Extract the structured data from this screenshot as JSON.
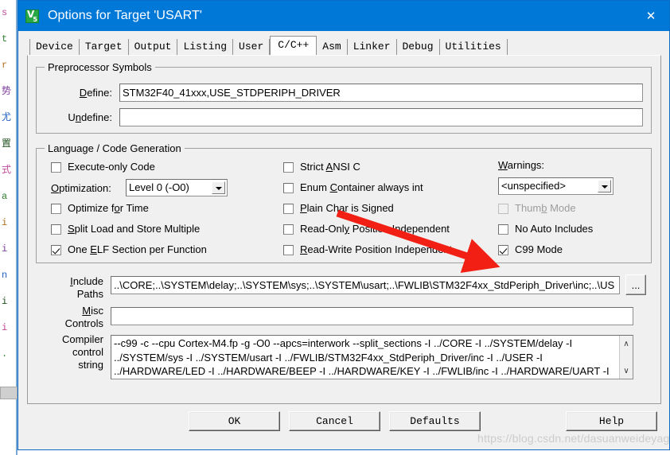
{
  "window": {
    "title": "Options for Target 'USART'",
    "icon": "keil-uvision-icon",
    "close_label": "✕"
  },
  "tabs": [
    {
      "label": "Device",
      "active": false
    },
    {
      "label": "Target",
      "active": false
    },
    {
      "label": "Output",
      "active": false
    },
    {
      "label": "Listing",
      "active": false
    },
    {
      "label": "User",
      "active": false
    },
    {
      "label": "C/C++",
      "active": true
    },
    {
      "label": "Asm",
      "active": false
    },
    {
      "label": "Linker",
      "active": false
    },
    {
      "label": "Debug",
      "active": false
    },
    {
      "label": "Utilities",
      "active": false
    }
  ],
  "preprocessor": {
    "legend": "Preprocessor Symbols",
    "define_label": "Define:",
    "define_value": "STM32F40_41xxx,USE_STDPERIPH_DRIVER",
    "undefine_label": "Undefine:",
    "undefine_value": ""
  },
  "language": {
    "legend": "Language / Code Generation",
    "left_column": [
      {
        "label": "Execute-only Code",
        "checked": false,
        "enabled": true
      },
      {
        "label": "Optimize for Time",
        "checked": false,
        "enabled": true
      },
      {
        "label": "Split Load and Store Multiple",
        "checked": false,
        "enabled": true
      },
      {
        "label": "One ELF Section per Function",
        "checked": true,
        "enabled": true
      }
    ],
    "optimization_label": "Optimization:",
    "optimization_value": "Level 0 (-O0)",
    "middle_column": [
      {
        "label": "Strict ANSI C",
        "checked": false,
        "enabled": true
      },
      {
        "label": "Enum Container always int",
        "checked": false,
        "enabled": true
      },
      {
        "label": "Plain Char is Signed",
        "checked": false,
        "enabled": true
      },
      {
        "label": "Read-Only Position Independent",
        "checked": false,
        "enabled": true
      },
      {
        "label": "Read-Write Position Independent",
        "checked": false,
        "enabled": true
      }
    ],
    "warnings_label": "Warnings:",
    "warnings_value": "<unspecified>",
    "right_column": [
      {
        "label": "Thumb Mode",
        "checked": false,
        "enabled": false
      },
      {
        "label": "No Auto Includes",
        "checked": false,
        "enabled": true
      },
      {
        "label": "C99 Mode",
        "checked": true,
        "enabled": true
      }
    ]
  },
  "paths": {
    "include_label_line1": "Include",
    "include_label_line2": "Paths",
    "include_value": "..\\CORE;..\\SYSTEM\\delay;..\\SYSTEM\\sys;..\\SYSTEM\\usart;..\\FWLIB\\STM32F4xx_StdPeriph_Driver\\inc;..\\US",
    "browse_label": "...",
    "misc_label_line1": "Misc",
    "misc_label_line2": "Controls",
    "misc_value": ""
  },
  "compiler": {
    "label_line1": "Compiler",
    "label_line2": "control",
    "label_line3": "string",
    "value_lines": [
      "--c99 -c --cpu Cortex-M4.fp -g -O0 --apcs=interwork --split_sections -I ../CORE -I ../SYSTEM/delay -I",
      "../SYSTEM/sys -I ../SYSTEM/usart -I ../FWLIB/STM32F4xx_StdPeriph_Driver/inc -I ../USER -I",
      "../HARDWARE/LED -I ../HARDWARE/BEEP -I ../HARDWARE/KEY -I ../FWLIB/inc -I ../HARDWARE/UART -I"
    ],
    "scroll_up": "∧",
    "scroll_down": "∨"
  },
  "buttons": [
    {
      "label": "OK"
    },
    {
      "label": "Cancel"
    },
    {
      "label": "Defaults"
    },
    {
      "label": "Help"
    }
  ],
  "annotation": {
    "type": "red-arrow",
    "color": "#f21f14",
    "points_to": "C99 Mode"
  },
  "watermark": "https://blog.csdn.net/dasuanweideyagao",
  "background_editor_lines": [
    "s",
    "t",
    "r",
    "势",
    "尤",
    "置",
    "式",
    "a",
    "i",
    "i",
    "n",
    "i",
    "i",
    "."
  ],
  "colors": {
    "titlebar": "#0078d7",
    "dialog_face": "#f0f0f0",
    "field_bg": "#ffffff",
    "annotation_red": "#f21f14"
  }
}
